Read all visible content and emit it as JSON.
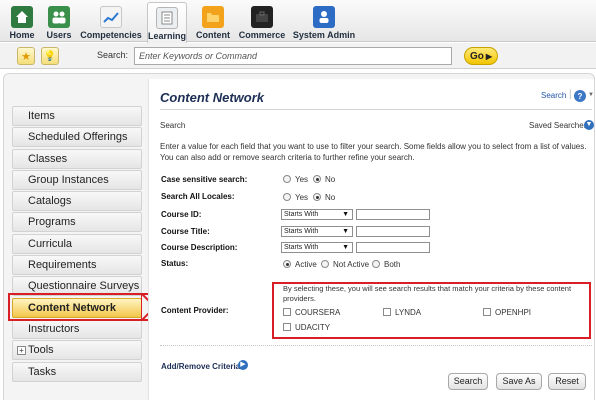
{
  "nav": {
    "items": [
      {
        "label": "Home",
        "icon": "home-icon",
        "color": "#2f7a3e"
      },
      {
        "label": "Users",
        "icon": "users-icon",
        "color": "#3a8f4b"
      },
      {
        "label": "Competencies",
        "icon": "competencies-icon",
        "color": "#2d7bd1"
      },
      {
        "label": "Learning",
        "icon": "learning-icon",
        "color": "#9aa0a6"
      },
      {
        "label": "Content",
        "icon": "content-icon",
        "color": "#f2a21b"
      },
      {
        "label": "Commerce",
        "icon": "commerce-icon",
        "color": "#222222"
      },
      {
        "label": "System Admin",
        "icon": "system-admin-icon",
        "color": "#2d6cc4"
      }
    ],
    "active": "Learning"
  },
  "searchbar": {
    "label": "Search:",
    "placeholder": "Enter Keywords or Command",
    "go_label": "Go"
  },
  "sidebar": {
    "items": [
      {
        "label": "Items"
      },
      {
        "label": "Scheduled Offerings"
      },
      {
        "label": "Classes"
      },
      {
        "label": "Group Instances"
      },
      {
        "label": "Catalogs"
      },
      {
        "label": "Programs"
      },
      {
        "label": "Curricula"
      },
      {
        "label": "Requirements"
      },
      {
        "label": "Questionnaire Surveys"
      },
      {
        "label": "Content Network"
      },
      {
        "label": "Instructors"
      },
      {
        "label": "Tools"
      },
      {
        "label": "Tasks"
      }
    ],
    "active": "Content Network"
  },
  "main": {
    "title": "Content Network",
    "header_search": "Search",
    "help": "?",
    "subheading": "Search",
    "saved_searches": "Saved Searches",
    "intro": "Enter a value for each field that you want to use to filter your search. Some fields allow you to select from a list of values. You can also add or remove search criteria to further refine your search.",
    "case_sensitive": {
      "label": "Case sensitive search:",
      "yes": "Yes",
      "no": "No"
    },
    "all_locales": {
      "label": "Search All Locales:",
      "yes": "Yes",
      "no": "No"
    },
    "course_id": {
      "label": "Course ID:",
      "operator": "Starts With"
    },
    "course_title": {
      "label": "Course Title:",
      "operator": "Starts With"
    },
    "course_description": {
      "label": "Course Description:",
      "operator": "Starts With"
    },
    "status": {
      "label": "Status:",
      "active": "Active",
      "not_active": "Not Active",
      "both": "Both"
    },
    "content_provider": {
      "label": "Content Provider:",
      "note": "By selecting these, you will see search results that match your criteria by these content providers.",
      "options": [
        "COURSERA",
        "LYNDA",
        "OPENHPI",
        "UDACITY"
      ]
    },
    "add_remove": "Add/Remove Criteria",
    "buttons": {
      "search": "Search",
      "save_as": "Save As",
      "reset": "Reset"
    }
  },
  "colors": {
    "accent": "#f2c500",
    "highlight": "#d81f26",
    "title": "#1d2e55"
  }
}
